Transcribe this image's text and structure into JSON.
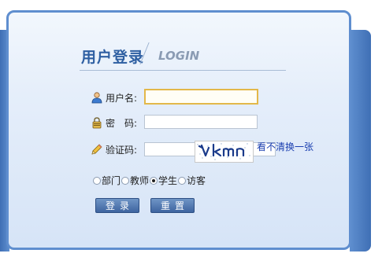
{
  "login": {
    "title": "用户登录",
    "subtitle": "LOGIN",
    "username_label": "用户名:",
    "username_value": "",
    "password_label": "密　码:",
    "password_value": "",
    "captcha_label": "验证码:",
    "captcha_value": "",
    "captcha_refresh_link": "看不清换一张",
    "roles": [
      {
        "label": "部门",
        "checked": false
      },
      {
        "label": "教师",
        "checked": false
      },
      {
        "label": "学生",
        "checked": true
      },
      {
        "label": "访客",
        "checked": false
      }
    ],
    "login_button": "登录",
    "reset_button": "重置"
  },
  "colors": {
    "accent": "#2e5fa2",
    "panel_border": "#5f8ecf",
    "link": "#1a3fb0"
  }
}
